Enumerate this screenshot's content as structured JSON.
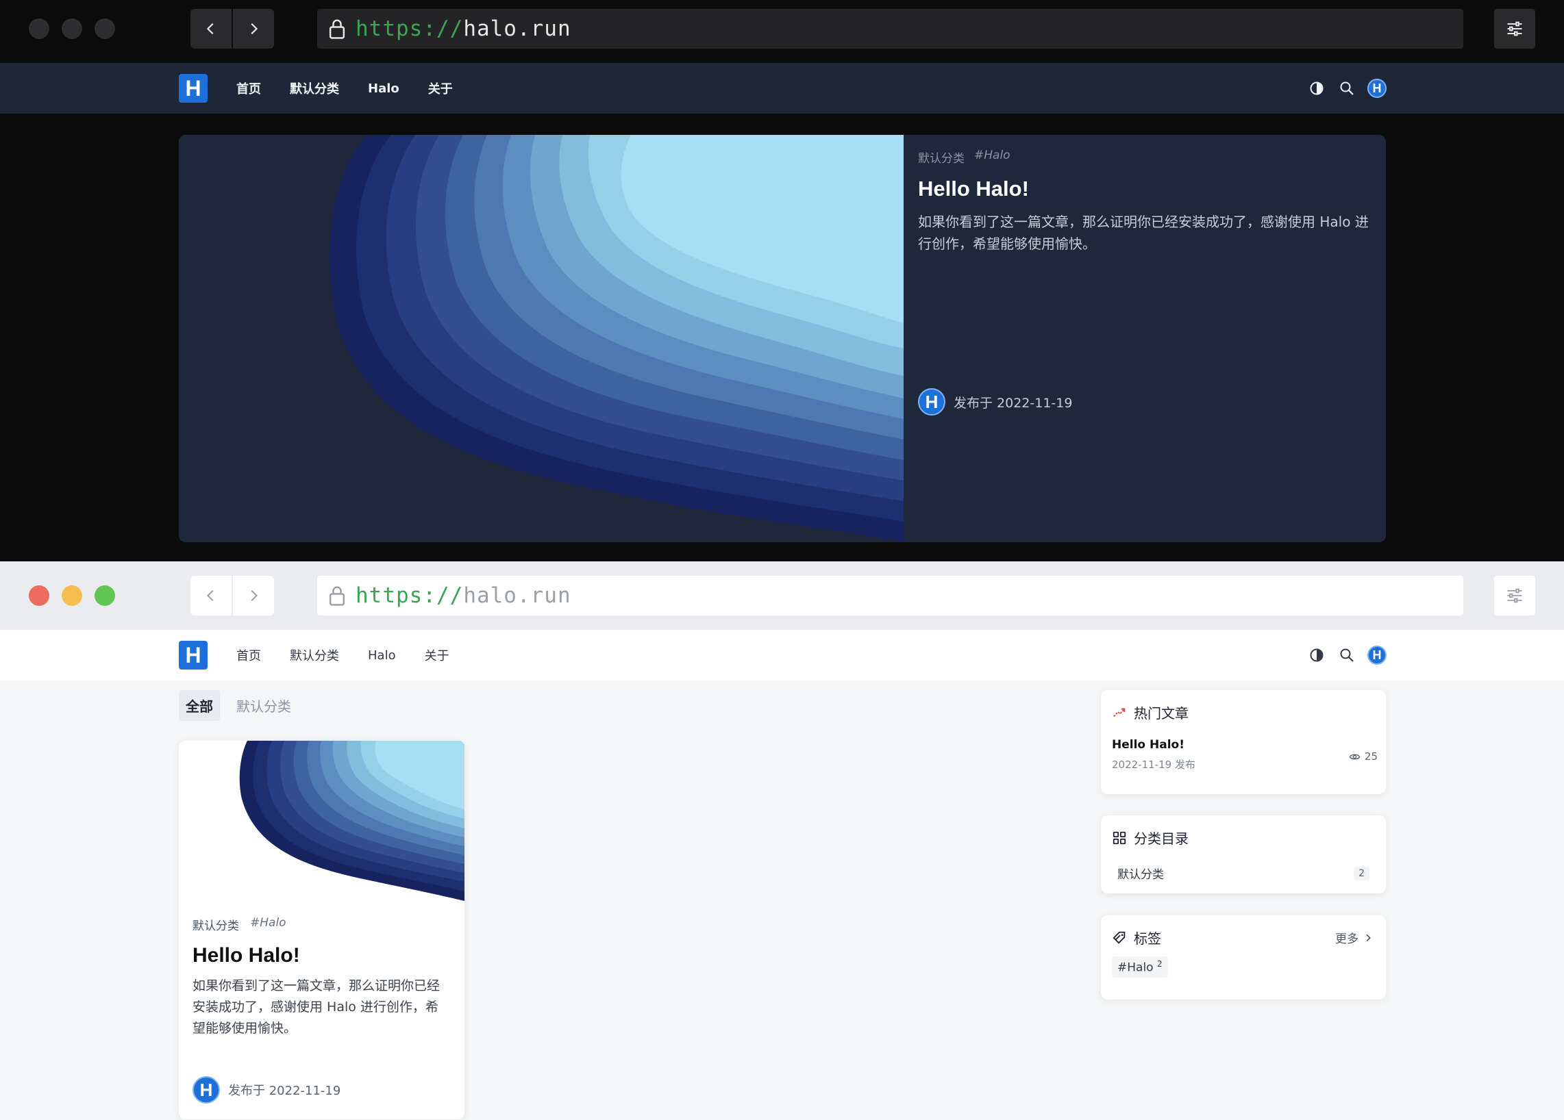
{
  "browser": {
    "url_scheme": "https://",
    "url_host": "halo.run"
  },
  "traffic_lights": {
    "light": [
      "#ee6b60",
      "#f6be50",
      "#62c655"
    ]
  },
  "nav": {
    "logo_letter": "H",
    "items": [
      "首页",
      "默认分类",
      "Halo",
      "关于"
    ],
    "avatar_letter": "H"
  },
  "dark": {
    "hero": {
      "category": "默认分类",
      "tag": "#Halo",
      "title": "Hello Halo!",
      "excerpt": "如果你看到了这一篇文章，那么证明你已经安装成功了，感谢使用 Halo 进行创作，希望能够使用愉快。",
      "author_letter": "H",
      "published": "发布于 2022-11-19"
    }
  },
  "light": {
    "tabs": [
      "全部",
      "默认分类"
    ],
    "post": {
      "category": "默认分类",
      "tag": "#Halo",
      "title": "Hello Halo!",
      "excerpt": "如果你看到了这一篇文章，那么证明你已经安装成功了，感谢使用 Halo 进行创作，希望能够使用愉快。",
      "author_letter": "H",
      "published": "发布于 2022-11-19"
    },
    "sidebar": {
      "popular": {
        "title": "热门文章",
        "item_title": "Hello Halo!",
        "item_date": "2022-11-19 发布",
        "views": "25"
      },
      "categories": {
        "title": "分类目录",
        "name": "默认分类",
        "count": "2"
      },
      "tags": {
        "title": "标签",
        "more": "更多",
        "tag_name": "#Halo",
        "tag_count": "2"
      }
    }
  },
  "colors": {
    "accent_blue": "#1d70d8",
    "url_green": "#3aa655",
    "hot_red": "#e04b4b"
  }
}
